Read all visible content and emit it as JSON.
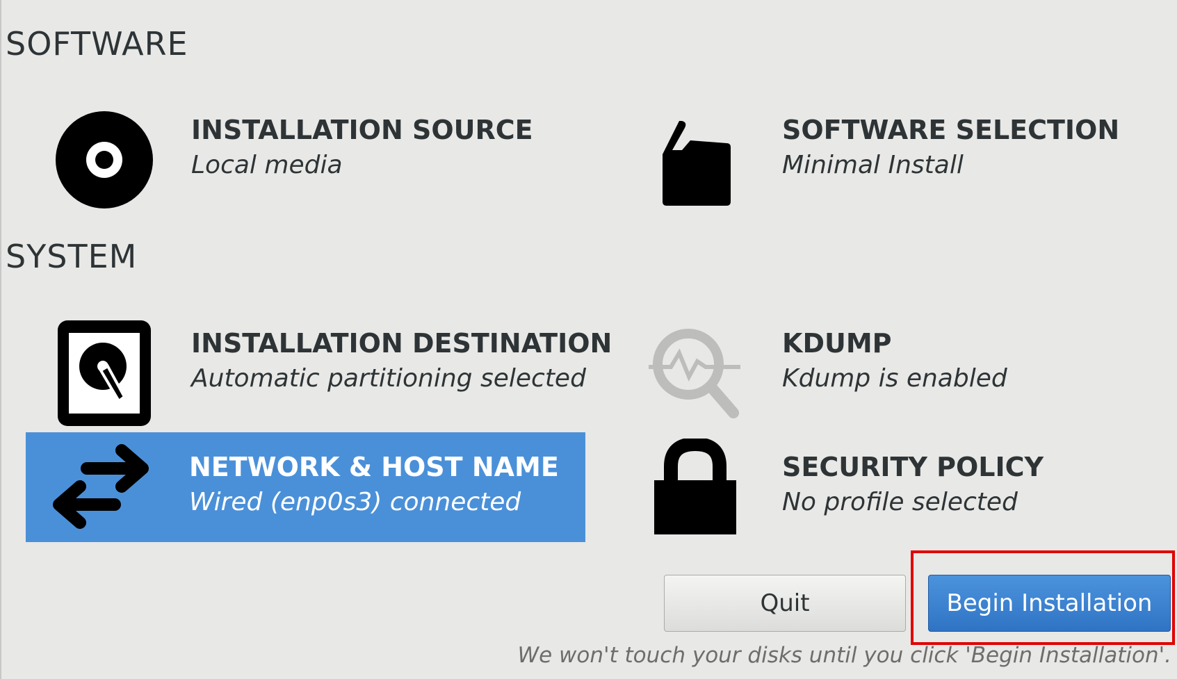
{
  "sections": {
    "software": "SOFTWARE",
    "system": "SYSTEM"
  },
  "spokes": {
    "installation_source": {
      "title": "INSTALLATION SOURCE",
      "status": "Local media",
      "icon": "disc-icon"
    },
    "software_selection": {
      "title": "SOFTWARE SELECTION",
      "status": "Minimal Install",
      "icon": "package-icon"
    },
    "installation_destination": {
      "title": "INSTALLATION DESTINATION",
      "status": "Automatic partitioning selected",
      "icon": "hard-disk-icon"
    },
    "kdump": {
      "title": "KDUMP",
      "status": "Kdump is enabled",
      "icon": "magnifier-icon"
    },
    "network": {
      "title": "NETWORK & HOST NAME",
      "status": "Wired (enp0s3) connected",
      "icon": "network-arrows-icon"
    },
    "security_policy": {
      "title": "SECURITY POLICY",
      "status": "No profile selected",
      "icon": "lock-icon"
    }
  },
  "buttons": {
    "quit": "Quit",
    "begin": "Begin Installation"
  },
  "hint": "We won't touch your disks until you click 'Begin Installation'.",
  "colors": {
    "background": "#e8e8e7",
    "selected": "#4a90d9",
    "primary_button": "#3a80cf",
    "highlight": "#e00000"
  }
}
